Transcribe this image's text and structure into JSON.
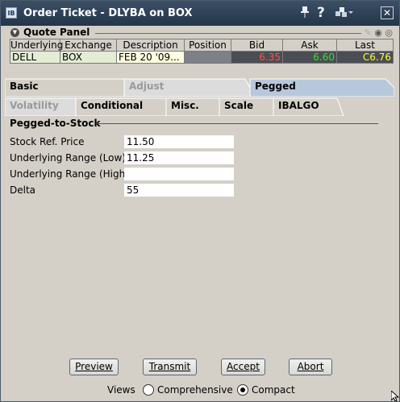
{
  "window": {
    "title": "Order Ticket - DLYBA on BOX",
    "app_icon": "IB",
    "icons": [
      "pin-icon",
      "help-icon",
      "share-icon",
      "close-icon"
    ]
  },
  "quote_panel": {
    "title": "Quote Panel",
    "columns": [
      "Underlying",
      "Exchange",
      "Description",
      "Position",
      "Bid",
      "Ask",
      "Last"
    ],
    "row": {
      "underlying": "DELL",
      "exchange": "BOX",
      "description": "FEB 20 '09...",
      "position": "",
      "bid": "6.35",
      "ask": "6.60",
      "last": "C6.76"
    },
    "colors": {
      "bid": "#ff5050",
      "ask": "#33dd33",
      "last": "#ffff33"
    }
  },
  "tabs_row1": [
    {
      "label": "Basic",
      "selected": false
    },
    {
      "label": "Adjust",
      "disabled": true
    },
    {
      "label": "Pegged",
      "selected": true
    }
  ],
  "tabs_row2": [
    {
      "label": "Volatility",
      "disabled": true
    },
    {
      "label": "Conditional"
    },
    {
      "label": "Misc."
    },
    {
      "label": "Scale"
    },
    {
      "label": "IBALGO"
    }
  ],
  "pegged_section": {
    "title": "Pegged-to-Stock",
    "fields": [
      {
        "label": "Stock Ref. Price",
        "value": "11.50"
      },
      {
        "label": "Underlying Range (Low)",
        "value": "11.25"
      },
      {
        "label": "Underlying Range (High)",
        "value": ""
      },
      {
        "label": "Delta",
        "value": "55"
      }
    ]
  },
  "buttons": {
    "preview": "Preview",
    "transmit": "Transmit",
    "accept": "Accept",
    "abort": "Abort"
  },
  "views": {
    "label": "Views",
    "options": [
      {
        "label": "Comprehensive",
        "checked": false
      },
      {
        "label": "Compact",
        "checked": true
      }
    ]
  }
}
